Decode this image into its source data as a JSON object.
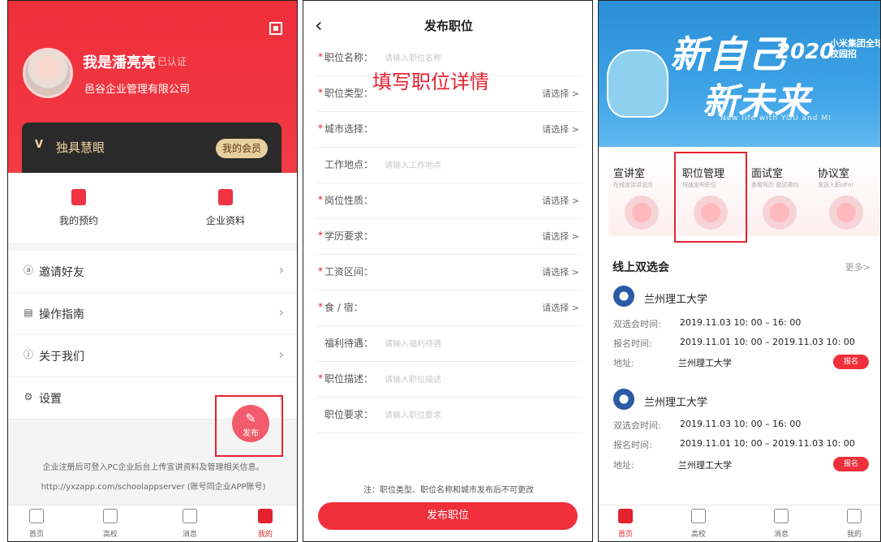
{
  "panel1": {
    "user_name": "我是潘亮亮",
    "verified_badge": "已认证",
    "company": "邑谷企业管理有限公司",
    "vip_logo": "V",
    "vip_title": "独具慧眼",
    "vip_button": "我的会员",
    "quick_actions": [
      {
        "label": "我的预约"
      },
      {
        "label": "企业资料"
      }
    ],
    "menu": [
      {
        "label": "邀请好友",
        "icon": "person-icon"
      },
      {
        "label": "操作指南",
        "icon": "book-icon"
      },
      {
        "label": "关于我们",
        "icon": "info-icon"
      },
      {
        "label": "设置",
        "icon": "gear-icon"
      }
    ],
    "fab_label": "发布",
    "note_line1": "企业注册后可登入PC企业后台上传宣讲资料及管理相关信息。",
    "note_line2": "http://yxzapp.com/schoolappserver (账号同企业APP账号)",
    "tabs": [
      {
        "label": "首页"
      },
      {
        "label": "高校"
      },
      {
        "label": "消息"
      },
      {
        "label": "我的"
      }
    ]
  },
  "panel2": {
    "back_icon": "‹",
    "title": "发布职位",
    "overlay_text": "填写职位详情",
    "fields": [
      {
        "label": "职位名称：",
        "required": "*",
        "placeholder": "请输入职位名称",
        "select": ""
      },
      {
        "label": "职位类型：",
        "required": "*",
        "placeholder": "",
        "select": "请选择 >"
      },
      {
        "label": "城市选择：",
        "required": "*",
        "placeholder": "",
        "select": "请选择 >"
      },
      {
        "label": "工作地点：",
        "required": "",
        "placeholder": "请输入工作地点",
        "select": ""
      },
      {
        "label": "岗位性质：",
        "required": "*",
        "placeholder": "",
        "select": "请选择 >"
      },
      {
        "label": "学历要求：",
        "required": "*",
        "placeholder": "",
        "select": "请选择 >"
      },
      {
        "label": "工资区间：",
        "required": "*",
        "placeholder": "",
        "select": "请选择 >"
      },
      {
        "label": "食 / 宿：",
        "required": "*",
        "placeholder": "",
        "select": "请选择 >"
      },
      {
        "label": "福利待遇：",
        "required": "",
        "placeholder": "请输入福利待遇",
        "select": ""
      },
      {
        "label": "职位描述：",
        "required": "*",
        "placeholder": "请输入职位描述",
        "select": ""
      },
      {
        "label": "职位要求：",
        "required": "",
        "placeholder": "请输入职位要求",
        "select": ""
      }
    ],
    "note": "注：职位类型、职位名称和城市发布后不可更改",
    "submit": "发布职位"
  },
  "panel3": {
    "banner_big1": "新自己",
    "banner_big2": "新未来",
    "banner_year": "2020",
    "banner_company": "小米集团全球校园招",
    "banner_sub": "New life with YOU and MI",
    "cards": [
      {
        "title": "宣讲室",
        "sub": "在线宣讲讲说历"
      },
      {
        "title": "职位管理",
        "sub": "快速发布职位"
      },
      {
        "title": "面试室",
        "sub": "查看简历 面试邀约"
      },
      {
        "title": "协议室",
        "sub": "发送入职offer"
      }
    ],
    "section_title": "线上双选会",
    "section_more": "更多>",
    "schools": [
      {
        "name": "兰州理工大学",
        "k1": "双选会时间:",
        "v1": "2019.11.03  10: 00 – 16: 00",
        "k2": "报名时间:",
        "v2": "2019.11.01 10: 00 –  2019.11.03 10: 00",
        "k3": "地址:",
        "v3": "兰州理工大学",
        "btn": "报名"
      },
      {
        "name": "兰州理工大学",
        "k1": "双选会时间:",
        "v1": "2019.11.03  10: 00 – 16: 00",
        "k2": "报名时间:",
        "v2": "2019.11.01 10: 00 –  2019.11.03 10: 00",
        "k3": "地址:",
        "v3": "兰州理工大学",
        "btn": "报名"
      }
    ],
    "tabs": [
      {
        "label": "首页"
      },
      {
        "label": "高校"
      },
      {
        "label": "消息"
      },
      {
        "label": "我的"
      }
    ]
  }
}
